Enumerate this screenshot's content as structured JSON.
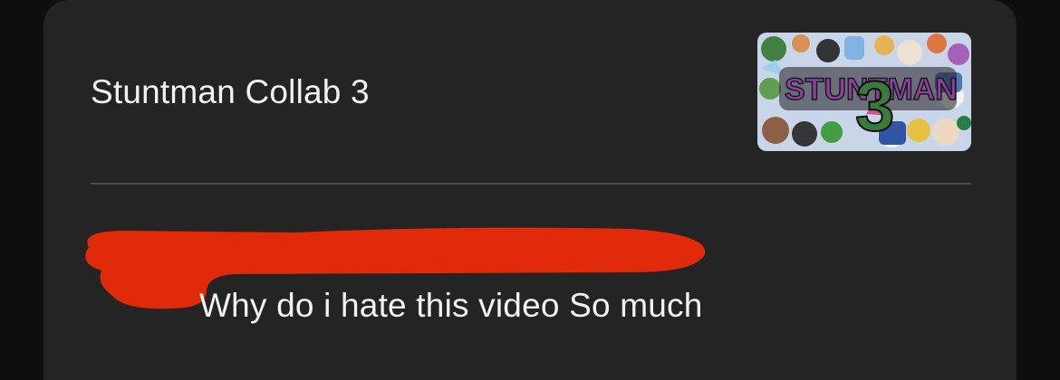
{
  "video": {
    "title": "Stuntman Collab 3",
    "thumbnail_text": "STUNTMAN",
    "thumbnail_number": "3"
  },
  "comment": {
    "author_redacted": true,
    "text": "Why do i hate this video So much"
  },
  "colors": {
    "background": "#0e0e0e",
    "card": "#242424",
    "text": "#f2f2f2",
    "divider": "#4a4a4a",
    "redaction": "#e02a0a"
  }
}
